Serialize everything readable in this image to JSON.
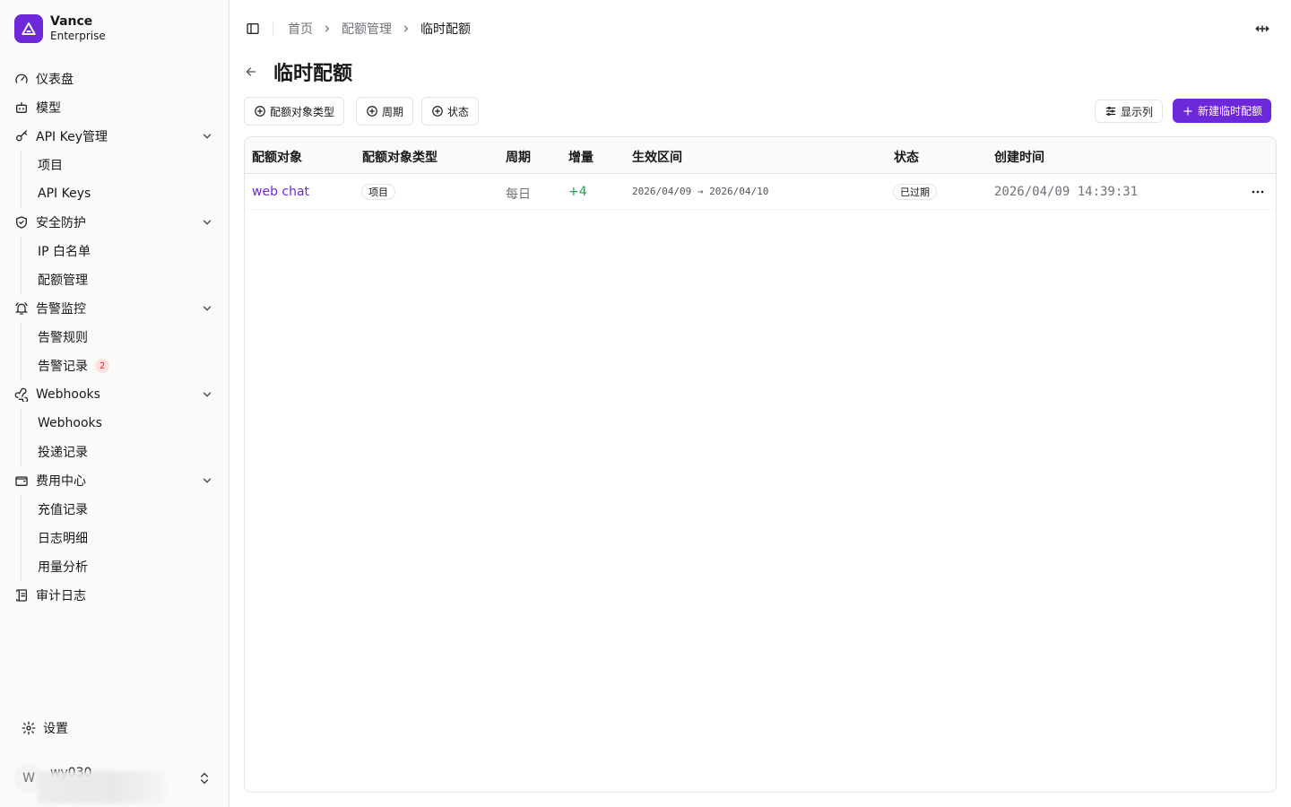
{
  "brand": {
    "name": "Vance",
    "subtitle": "Enterprise"
  },
  "nav": {
    "dashboard": "仪表盘",
    "models": "模型",
    "apikey_mgmt": "API Key管理",
    "apikey_sub": [
      "项目",
      "API Keys"
    ],
    "security": "安全防护",
    "security_sub": [
      "IP 白名单",
      "配额管理"
    ],
    "alerts": "告警监控",
    "alerts_sub": [
      "告警规则",
      "告警记录"
    ],
    "alerts_badge": "2",
    "webhooks": "Webhooks",
    "webhooks_sub": [
      "Webhooks",
      "投递记录"
    ],
    "billing": "费用中心",
    "billing_sub": [
      "充值记录",
      "日志明细",
      "用量分析"
    ],
    "audit": "审计日志",
    "settings": "设置"
  },
  "user": {
    "initial": "W",
    "name": "wy030"
  },
  "breadcrumb": [
    "首页",
    "配额管理",
    "临时配额"
  ],
  "page": {
    "title": "临时配额"
  },
  "filters": [
    "配额对象类型",
    "周期",
    "状态"
  ],
  "toolbar": {
    "columns_label": "显示列",
    "new_label": "新建临时配额"
  },
  "table": {
    "headers": [
      "配额对象",
      "配额对象类型",
      "周期",
      "增量",
      "生效区间",
      "状态",
      "创建时间"
    ],
    "rows": [
      {
        "target": "web chat",
        "type": "项目",
        "period": "每日",
        "increment": "+4",
        "range": "2026/04/09 → 2026/04/10",
        "status": "已过期",
        "created": "2026/04/09 14:39:31"
      }
    ]
  },
  "colors": {
    "accent": "#6d28d9",
    "increment": "#16a34a",
    "badge": "#dc2626"
  }
}
